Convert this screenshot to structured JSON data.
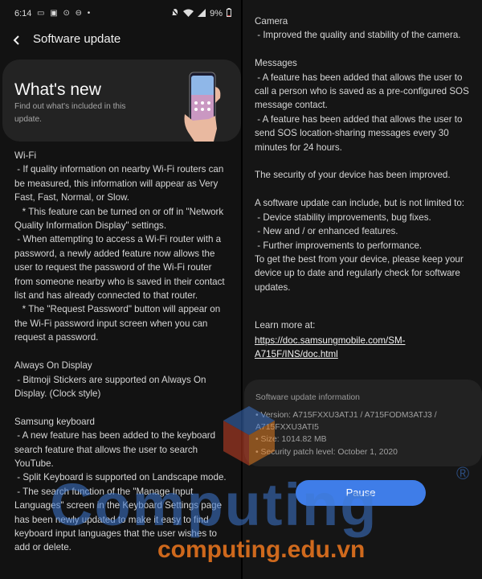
{
  "status_bar": {
    "time": "6:14",
    "battery": "9%"
  },
  "header": {
    "title": "Software update"
  },
  "whats_new": {
    "title": "What's new",
    "subtitle": "Find out what's included in this update."
  },
  "left_body": "Wi-Fi\n - If quality information on nearby Wi-Fi routers can be measured, this information will appear as Very Fast, Fast, Normal, or Slow.\n   * This feature can be turned on or off in \"Network Quality Information Display\" settings.\n - When attempting to access a Wi-Fi router with a password, a newly added feature now allows the user to request the password of the Wi-Fi router from someone nearby who is saved in their contact list and has already connected to that router.\n   * The \"Request Password\" button will appear on the Wi-Fi password input screen when you can request a password.\n\nAlways On Display\n - Bitmoji Stickers are supported on Always On Display. (Clock style)\n\nSamsung keyboard\n - A new feature has been added to the keyboard search feature that allows the user to search YouTube.\n - Split Keyboard is supported on Landscape mode.\n - The search function of the \"Manage Input Languages\" screen in the Keyboard Settings page has been newly updated to make it easy to find keyboard input languages that the user wishes to add or delete.",
  "right_body": "Camera\n - Improved the quality and stability of the camera.\n\nMessages\n - A feature has been added that allows the user to call a person who is saved as a pre-configured SOS message contact.\n - A feature has been added that allows the user to send SOS location-sharing messages every 30 minutes for 24 hours.\n\nThe security of your device has been improved.\n\nA software update can include, but is not limited to:\n - Device stability improvements, bug fixes.\n - New and / or enhanced features.\n - Further improvements to performance.\nTo get the best from your device, please keep your device up to date and regularly check for software updates.",
  "learn_more": {
    "label": "Learn more at:",
    "url": "https://doc.samsungmobile.com/SM-A715F/INS/doc.html"
  },
  "update_info": {
    "title": "Software update information",
    "lines": "• Version: A715FXXU3ATJ1 / A715FODM3ATJ3 / A715FXXU3ATI5\n• Size: 1014.82 MB\n• Security patch level: October 1, 2020"
  },
  "pause_label": "Pause",
  "watermark": {
    "brand": "Computing",
    "url": "computing.edu.vn",
    "reg": "®"
  },
  "colors": {
    "accent": "#3f7de8",
    "card": "#232323",
    "background": "#121212"
  }
}
